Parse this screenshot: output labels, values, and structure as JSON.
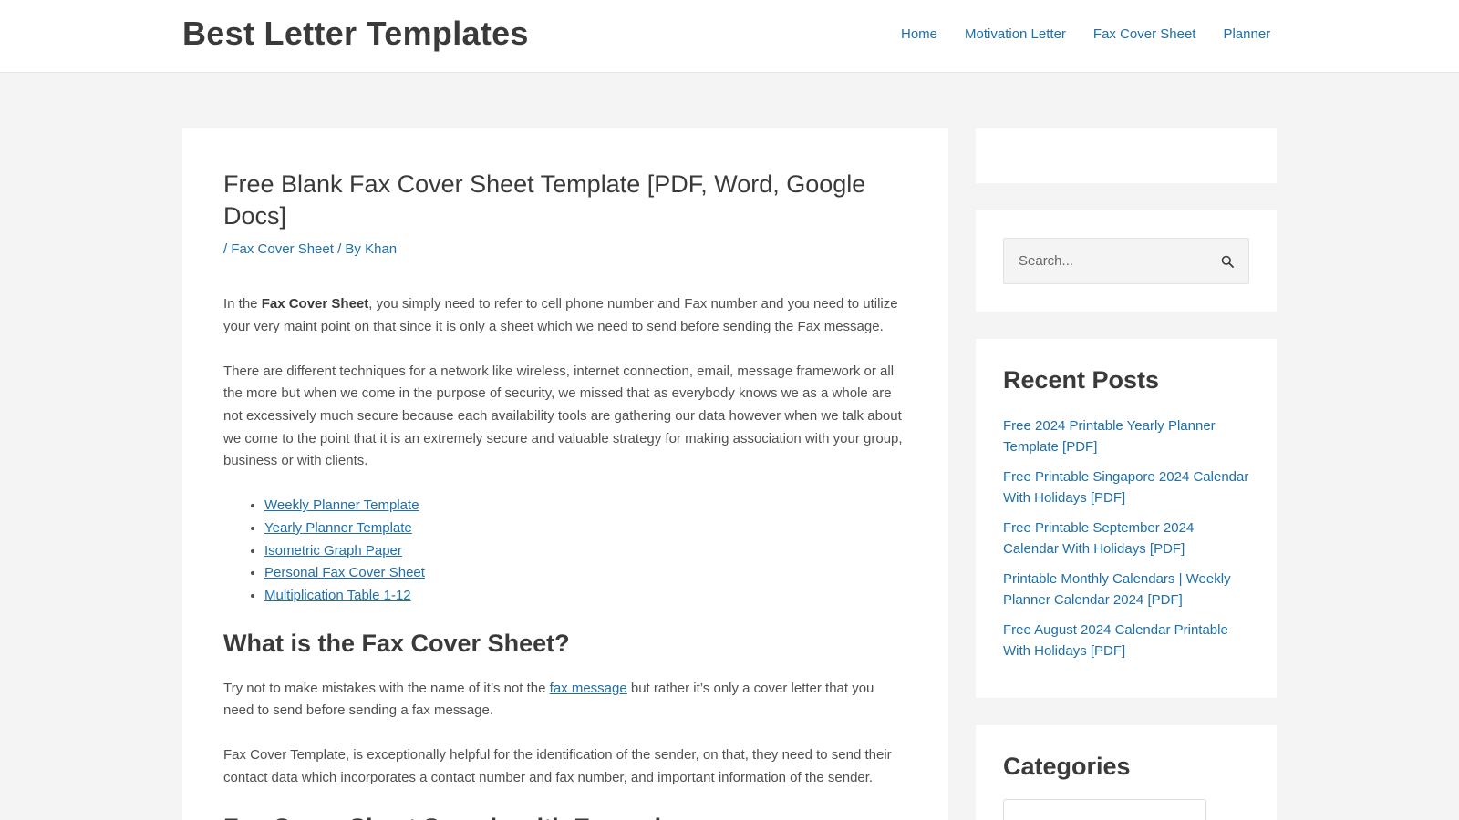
{
  "site": {
    "title": "Best Letter Templates"
  },
  "nav": [
    "Home",
    "Motivation Letter",
    "Fax Cover Sheet",
    "Planner"
  ],
  "article": {
    "title": "Free Blank Fax Cover Sheet Template [PDF, Word, Google Docs]",
    "meta": {
      "sep1": "/",
      "category": "Fax Cover Sheet",
      "by": "/ By",
      "author": "Khan"
    },
    "p1": {
      "before": "In the ",
      "bold": "Fax Cover Sheet",
      "after": ", you simply need to refer to cell phone number and Fax number and you need to utilize your very maint point on that since it is only a sheet which we need to send before sending the Fax message."
    },
    "p2": "There are different techniques for a network like wireless, internet connection, email, message framework or all the more but when we come in the purpose of security, we missed that as everybody knows we as a whole are not excessively much secure because each availability tools are gathering our data however when we talk about we come to the point that it is an extremely secure and valuable strategy for making association with your group, business or with clients.",
    "links": [
      "Weekly Planner Template",
      "Yearly Planner Template",
      "Isometric Graph Paper",
      "Personal Fax Cover Sheet",
      "Multiplication Table 1-12"
    ],
    "h2_1": "What is the Fax Cover Sheet?",
    "p3": {
      "before": "Try not to make mistakes with the name of it’s not the ",
      "link": "fax message",
      "after": " but rather it’s only a cover letter that you need to send before sending a fax message."
    },
    "p4": "Fax Cover Template, is exceptionally helpful for the identification of the sender, on that, they need to send their contact data which incorporates a contact number and fax number, and important information of the sender.",
    "h2_2": "Fax Cover Sheet Sample with Example"
  },
  "sidebar": {
    "search": {
      "placeholder": "Search..."
    },
    "recent": {
      "title": "Recent Posts",
      "items": [
        "Free 2024 Printable Yearly Planner Template [PDF]",
        "Free Printable Singapore 2024 Calendar With Holidays [PDF]",
        "Free Printable September 2024 Calendar With Holidays [PDF]",
        "Printable Monthly Calendars | Weekly Planner Calendar 2024 [PDF]",
        "Free August 2024 Calendar Printable With Holidays [PDF]"
      ]
    },
    "categories": {
      "title": "Categories"
    }
  },
  "colors": {
    "link": "#1e6fa8",
    "text": "#3a3a3a",
    "background": "#f4f4f4"
  },
  "icons": [
    "search-icon"
  ]
}
